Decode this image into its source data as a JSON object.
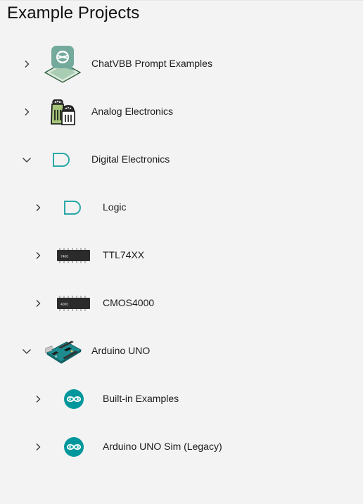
{
  "header": {
    "title": "Example Projects"
  },
  "tree": [
    {
      "label": "ChatVBB Prompt Examples",
      "level": 0,
      "expanded": false,
      "icon": "chatgpt-logo-icon"
    },
    {
      "label": "Analog Electronics",
      "level": 0,
      "expanded": false,
      "icon": "salt-pepper-shakers-icon"
    },
    {
      "label": "Digital Electronics",
      "level": 0,
      "expanded": true,
      "icon": "and-gate-icon"
    },
    {
      "label": "Logic",
      "level": 1,
      "expanded": false,
      "icon": "and-gate-icon"
    },
    {
      "label": "TTL74XX",
      "level": 1,
      "expanded": false,
      "icon": "ic-chip-icon",
      "chip_text": "7400"
    },
    {
      "label": "CMOS4000",
      "level": 1,
      "expanded": false,
      "icon": "ic-chip-icon",
      "chip_text": "4000"
    },
    {
      "label": "Arduino UNO",
      "level": 0,
      "expanded": true,
      "icon": "arduino-board-icon"
    },
    {
      "label": "Built-in Examples",
      "level": 1,
      "expanded": false,
      "icon": "arduino-logo-icon"
    },
    {
      "label": "Arduino UNO Sim (Legacy)",
      "level": 1,
      "expanded": false,
      "icon": "arduino-logo-icon"
    }
  ],
  "colors": {
    "accent_teal": "#2aa8a8",
    "arduino_teal": "#00979c",
    "chatgpt_green": "#74aa9c"
  }
}
